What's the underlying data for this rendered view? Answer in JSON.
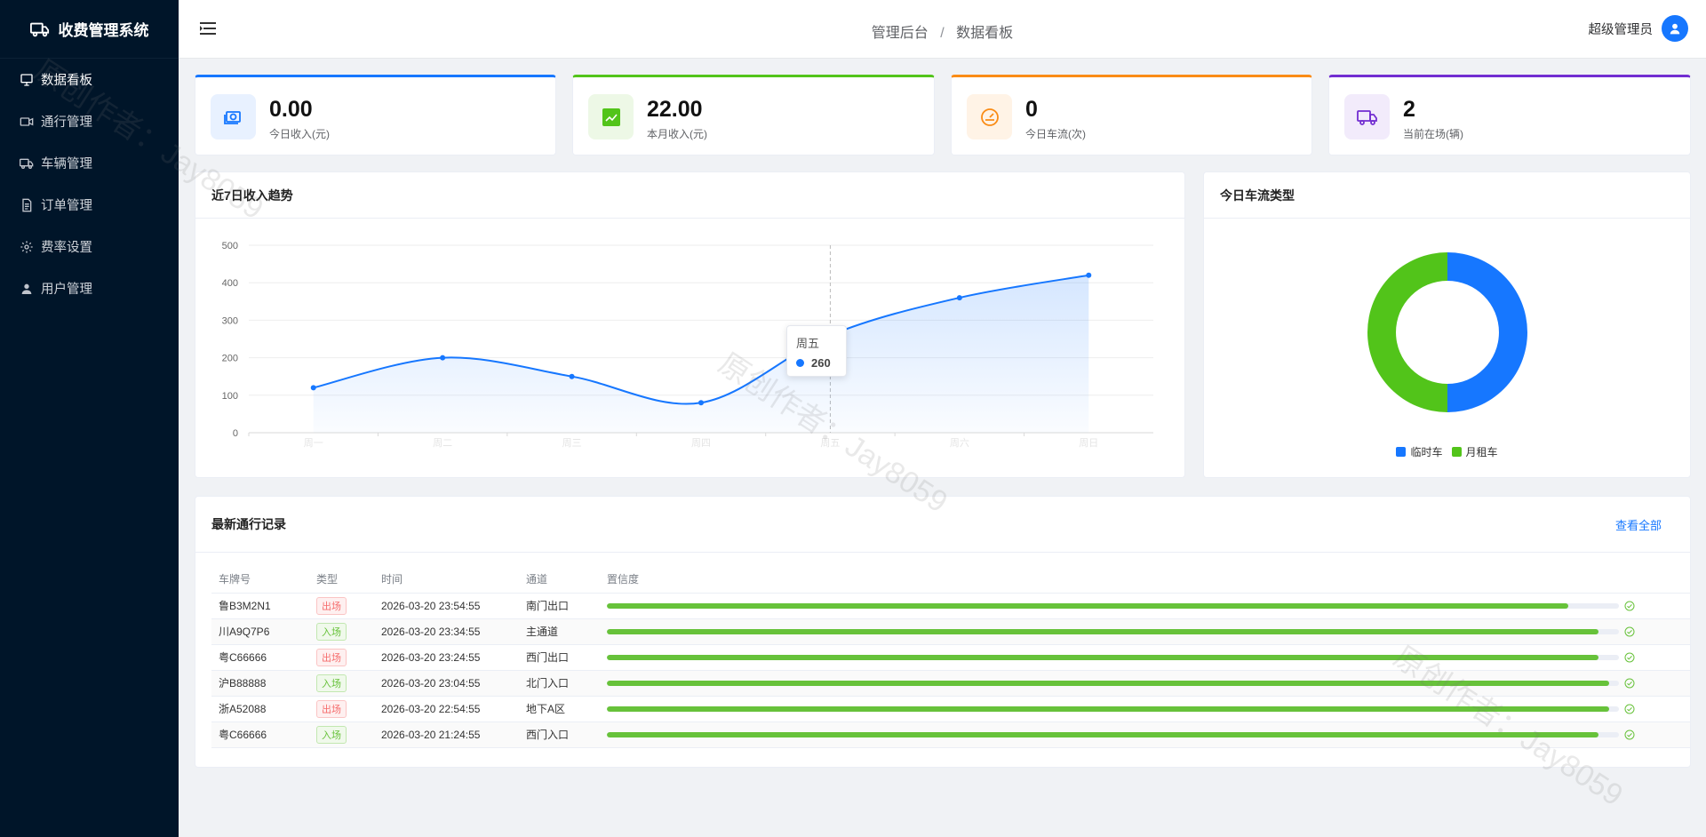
{
  "sidebar": {
    "title": "收费管理系统",
    "items": [
      {
        "label": "数据看板",
        "icon": "dashboard-icon"
      },
      {
        "label": "通行管理",
        "icon": "camera-icon"
      },
      {
        "label": "车辆管理",
        "icon": "truck-icon"
      },
      {
        "label": "订单管理",
        "icon": "document-icon"
      },
      {
        "label": "费率设置",
        "icon": "gear-icon"
      },
      {
        "label": "用户管理",
        "icon": "user-icon"
      }
    ]
  },
  "header": {
    "breadcrumb": [
      "管理后台",
      "数据看板"
    ],
    "separator": "/",
    "username": "超级管理员"
  },
  "stats": [
    {
      "value": "0.00",
      "label": "今日收入(元)",
      "color": "#1677ff",
      "icon": "money-icon"
    },
    {
      "value": "22.00",
      "label": "本月收入(元)",
      "color": "#52c41a",
      "icon": "trend-chart-icon"
    },
    {
      "value": "0",
      "label": "今日车流(次)",
      "color": "#fa8c16",
      "icon": "speedometer-icon"
    },
    {
      "value": "2",
      "label": "当前在场(辆)",
      "color": "#722ed1",
      "icon": "truck-icon"
    }
  ],
  "trend_panel": {
    "title": "近7日收入趋势",
    "tooltip": {
      "day": "周五",
      "value": "260"
    }
  },
  "pie_panel": {
    "title": "今日车流类型"
  },
  "records": {
    "title": "最新通行记录",
    "view_all": "查看全部",
    "columns": [
      "车牌号",
      "类型",
      "时间",
      "通道",
      "置信度"
    ],
    "rows": [
      {
        "plate": "鲁B3M2N1",
        "type": "出场",
        "kind": "out",
        "time": "2026-03-20 23:54:55",
        "lane": "南门出口",
        "confidence": 0.95
      },
      {
        "plate": "川A9Q7P6",
        "type": "入场",
        "kind": "in",
        "time": "2026-03-20 23:34:55",
        "lane": "主通道",
        "confidence": 0.98
      },
      {
        "plate": "粤C66666",
        "type": "出场",
        "kind": "out",
        "time": "2026-03-20 23:24:55",
        "lane": "西门出口",
        "confidence": 0.98
      },
      {
        "plate": "沪B88888",
        "type": "入场",
        "kind": "in",
        "time": "2026-03-20 23:04:55",
        "lane": "北门入口",
        "confidence": 0.99
      },
      {
        "plate": "浙A52088",
        "type": "出场",
        "kind": "out",
        "time": "2026-03-20 22:54:55",
        "lane": "地下A区",
        "confidence": 0.99
      },
      {
        "plate": "粤C66666",
        "type": "入场",
        "kind": "in",
        "time": "2026-03-20 21:24:55",
        "lane": "西门入口",
        "confidence": 0.98
      }
    ]
  },
  "watermark_text": "原创作者：Jay8059",
  "chart_data": [
    {
      "type": "area",
      "title": "近7日收入趋势",
      "categories": [
        "周一",
        "周二",
        "周三",
        "周四",
        "周五",
        "周六",
        "周日"
      ],
      "values": [
        120,
        200,
        150,
        80,
        260,
        360,
        420
      ],
      "ylim": [
        0,
        500
      ],
      "yticks": [
        0,
        100,
        200,
        300,
        400,
        500
      ],
      "grid": true,
      "color": "#1677ff"
    },
    {
      "type": "pie",
      "title": "今日车流类型",
      "donut": true,
      "slices": [
        {
          "name": "临时车",
          "value": 50,
          "color": "#1677ff"
        },
        {
          "name": "月租车",
          "value": 50,
          "color": "#52c41a"
        }
      ],
      "legend": "bottom"
    }
  ]
}
